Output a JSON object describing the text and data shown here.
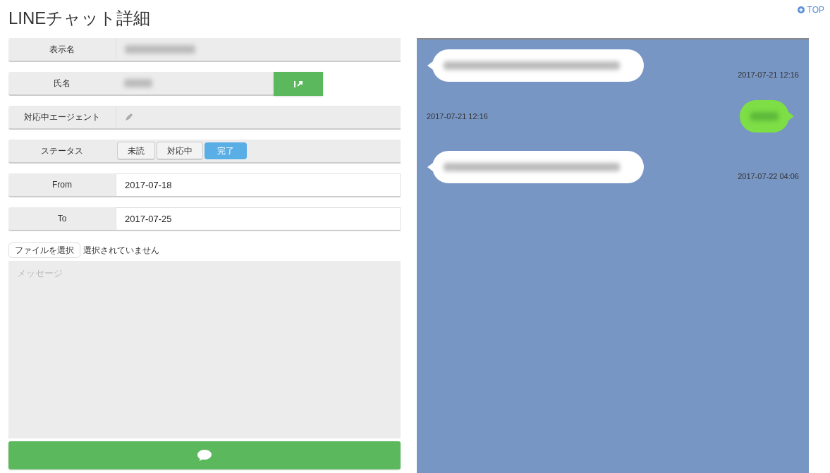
{
  "top_link": {
    "label": "TOP"
  },
  "title": "LINEチャット詳細",
  "fields": [
    {
      "kind": "blurred",
      "label": "表示名"
    },
    {
      "kind": "blurred_button",
      "label": "氏名"
    },
    {
      "kind": "edit",
      "label": "対応中エージェント"
    },
    {
      "kind": "status",
      "label": "ステータス",
      "options": [
        {
          "label": "未読",
          "selected": false
        },
        {
          "label": "対応中",
          "selected": false
        },
        {
          "label": "完了",
          "selected": true
        }
      ]
    },
    {
      "kind": "input",
      "label": "From",
      "value": "2017-07-18"
    },
    {
      "kind": "input",
      "label": "To",
      "value": "2017-07-25"
    }
  ],
  "file": {
    "button": "ファイルを選択",
    "status": "選択されていません"
  },
  "message": {
    "placeholder": "メッセージ"
  },
  "chat": [
    {
      "kind": "incoming",
      "time": "2017-07-21 12:16"
    },
    {
      "kind": "outgoing",
      "time": "2017-07-21 12:16"
    },
    {
      "kind": "incoming",
      "time": "2017-07-22 04:06"
    }
  ]
}
